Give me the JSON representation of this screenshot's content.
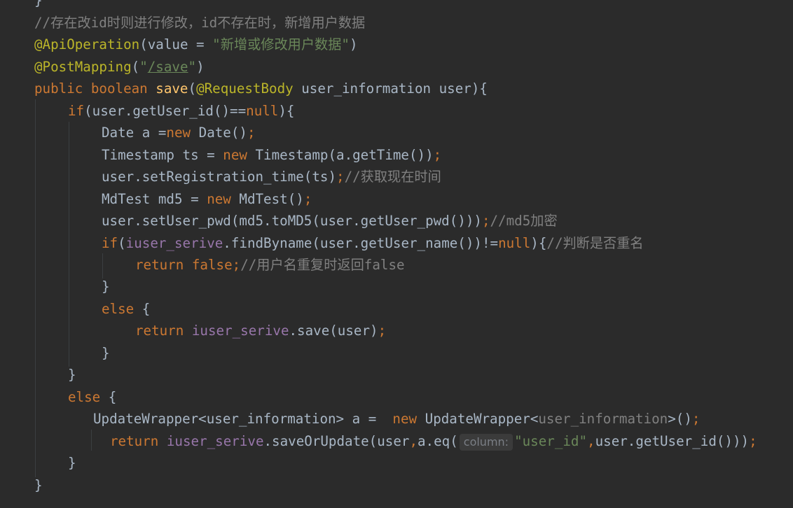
{
  "editor": {
    "lines": [
      {
        "id": "l0",
        "tokens": [
          {
            "t": "}",
            "c": "def"
          }
        ]
      },
      {
        "id": "l1",
        "tokens": [
          {
            "t": "//存在改id时则进行修改，id不存在时，新增用户数据",
            "c": "cmt"
          }
        ]
      },
      {
        "id": "l2",
        "tokens": [
          {
            "t": "@ApiOperation",
            "c": "ann"
          },
          {
            "t": "(value = ",
            "c": "def"
          },
          {
            "t": "\"新增或修改用户数据\"",
            "c": "str"
          },
          {
            "t": ")",
            "c": "def"
          }
        ]
      },
      {
        "id": "l3",
        "tokens": [
          {
            "t": "@PostMapping",
            "c": "ann"
          },
          {
            "t": "(",
            "c": "def"
          },
          {
            "t": "\"",
            "c": "str"
          },
          {
            "t": "/save",
            "c": "str u"
          },
          {
            "t": "\"",
            "c": "str"
          },
          {
            "t": ")",
            "c": "def"
          }
        ]
      },
      {
        "id": "l4",
        "tokens": [
          {
            "t": "public boolean ",
            "c": "kw"
          },
          {
            "t": "save",
            "c": "fn"
          },
          {
            "t": "(",
            "c": "def"
          },
          {
            "t": "@RequestBody ",
            "c": "ann"
          },
          {
            "t": "user_information user){",
            "c": "def"
          }
        ]
      },
      {
        "id": "l5",
        "tokens": [
          {
            "t": "if",
            "c": "kw"
          },
          {
            "t": "(user.getUser_id()==",
            "c": "def"
          },
          {
            "t": "null",
            "c": "kw"
          },
          {
            "t": "){",
            "c": "def"
          }
        ]
      },
      {
        "id": "l6",
        "tokens": [
          {
            "t": "Date a =",
            "c": "def"
          },
          {
            "t": "new ",
            "c": "kw"
          },
          {
            "t": "Date()",
            "c": "def"
          },
          {
            "t": ";",
            "c": "kw"
          }
        ]
      },
      {
        "id": "l7",
        "tokens": [
          {
            "t": "Timestamp ts = ",
            "c": "def"
          },
          {
            "t": "new ",
            "c": "kw"
          },
          {
            "t": "Timestamp(a.getTime())",
            "c": "def"
          },
          {
            "t": ";",
            "c": "kw"
          }
        ]
      },
      {
        "id": "l8",
        "tokens": [
          {
            "t": "user.setRegistration_time(ts)",
            "c": "def"
          },
          {
            "t": ";",
            "c": "kw"
          },
          {
            "t": "//获取现在时间",
            "c": "cmt"
          }
        ]
      },
      {
        "id": "l9",
        "tokens": [
          {
            "t": "MdTest md5 = ",
            "c": "def"
          },
          {
            "t": "new ",
            "c": "kw"
          },
          {
            "t": "MdTest()",
            "c": "def"
          },
          {
            "t": ";",
            "c": "kw"
          }
        ]
      },
      {
        "id": "l10",
        "tokens": [
          {
            "t": "user.setUser_pwd(md5.toMD5(user.getUser_pwd()))",
            "c": "def"
          },
          {
            "t": ";",
            "c": "kw"
          },
          {
            "t": "//md5加密",
            "c": "cmt"
          }
        ]
      },
      {
        "id": "l11",
        "tokens": [
          {
            "t": "if",
            "c": "kw"
          },
          {
            "t": "(",
            "c": "def"
          },
          {
            "t": "iuser_serive",
            "c": "fld"
          },
          {
            "t": ".findByname(user.getUser_name())!=",
            "c": "def"
          },
          {
            "t": "null",
            "c": "kw"
          },
          {
            "t": "){",
            "c": "def"
          },
          {
            "t": "//判断是否重名",
            "c": "cmt"
          }
        ]
      },
      {
        "id": "l12",
        "tokens": [
          {
            "t": "return false",
            "c": "kw"
          },
          {
            "t": ";",
            "c": "kw"
          },
          {
            "t": "//用户名重复时返回false",
            "c": "cmt"
          }
        ]
      },
      {
        "id": "l13",
        "tokens": [
          {
            "t": "}",
            "c": "def"
          }
        ]
      },
      {
        "id": "l14",
        "tokens": [
          {
            "t": "else ",
            "c": "kw"
          },
          {
            "t": "{",
            "c": "def"
          }
        ]
      },
      {
        "id": "l15",
        "tokens": [
          {
            "t": "return ",
            "c": "kw"
          },
          {
            "t": "iuser_serive",
            "c": "fld"
          },
          {
            "t": ".save(user)",
            "c": "def"
          },
          {
            "t": ";",
            "c": "kw"
          }
        ]
      },
      {
        "id": "l16",
        "tokens": [
          {
            "t": "}",
            "c": "def"
          }
        ]
      },
      {
        "id": "l17",
        "tokens": [
          {
            "t": "}",
            "c": "def"
          }
        ]
      },
      {
        "id": "l18",
        "tokens": [
          {
            "t": "else ",
            "c": "kw"
          },
          {
            "t": "{",
            "c": "def"
          }
        ]
      },
      {
        "id": "l19",
        "tokens": [
          {
            "t": "UpdateWrapper<user_information> a =  ",
            "c": "def"
          },
          {
            "t": "new ",
            "c": "kw"
          },
          {
            "t": "UpdateWrapper<",
            "c": "def"
          },
          {
            "t": "user_information",
            "c": "cmt"
          },
          {
            "t": ">()",
            "c": "def"
          },
          {
            "t": ";",
            "c": "kw"
          }
        ]
      },
      {
        "id": "l20",
        "tokens": [
          {
            "t": "return ",
            "c": "kw"
          },
          {
            "t": "iuser_serive",
            "c": "fld"
          },
          {
            "t": ".saveOrUpdate(user",
            "c": "def"
          },
          {
            "t": ",",
            "c": "kw"
          },
          {
            "t": "a.eq(",
            "c": "def"
          },
          {
            "t": "column:",
            "c": "hint"
          },
          {
            "t": "\"user_id\"",
            "c": "str"
          },
          {
            "t": ",",
            "c": "kw"
          },
          {
            "t": "user.getUser_id()))",
            "c": "def"
          },
          {
            "t": ";",
            "c": "kw"
          }
        ]
      },
      {
        "id": "l21",
        "tokens": [
          {
            "t": "}",
            "c": "def"
          }
        ]
      },
      {
        "id": "l22",
        "tokens": [
          {
            "t": "}",
            "c": "def"
          }
        ]
      }
    ]
  }
}
